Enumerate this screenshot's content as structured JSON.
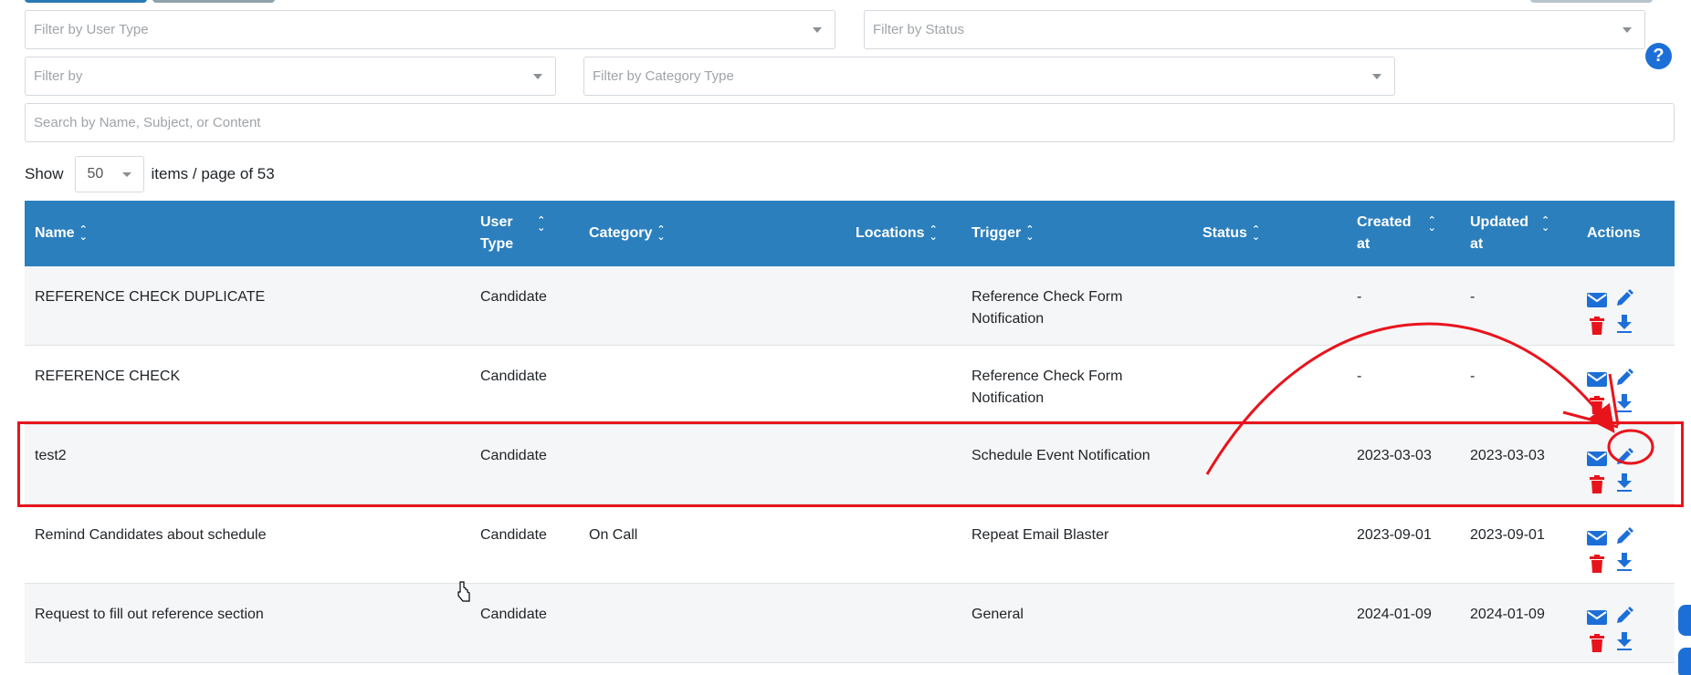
{
  "filters": {
    "user_type_placeholder": "Filter by User Type",
    "status_placeholder": "Filter by Status",
    "filter_by_placeholder": "Filter by",
    "category_type_placeholder": "Filter by Category Type",
    "search_placeholder": "Search by Name, Subject, or Content"
  },
  "help_label": "?",
  "pagination": {
    "show_label": "Show",
    "page_size": "50",
    "items_label": "items / page of 53"
  },
  "table": {
    "headers": {
      "name": "Name",
      "user_type_1": "User",
      "user_type_2": "Type",
      "category": "Category",
      "locations": "Locations",
      "trigger": "Trigger",
      "status": "Status",
      "created_1": "Created",
      "created_2": "at",
      "updated_1": "Updated",
      "updated_2": "at",
      "actions": "Actions"
    },
    "rows": [
      {
        "name": "REFERENCE CHECK DUPLICATE",
        "user_type": "Candidate",
        "category": "",
        "locations": "",
        "trigger_1": "Reference Check Form",
        "trigger_2": "Notification",
        "status": "",
        "created": "-",
        "updated": "-"
      },
      {
        "name": "REFERENCE CHECK",
        "user_type": "Candidate",
        "category": "",
        "locations": "",
        "trigger_1": "Reference Check Form",
        "trigger_2": "Notification",
        "status": "",
        "created": "-",
        "updated": "-"
      },
      {
        "name": "test2",
        "user_type": "Candidate",
        "category": "",
        "locations": "",
        "trigger_1": "Schedule Event Notification",
        "trigger_2": "",
        "status": "",
        "created": "2023-03-03",
        "updated": "2023-03-03"
      },
      {
        "name": "Remind Candidates about schedule",
        "user_type": "Candidate",
        "category": "On Call",
        "locations": "",
        "trigger_1": "Repeat Email Blaster",
        "trigger_2": "",
        "status": "",
        "created": "2023-09-01",
        "updated": "2023-09-01"
      },
      {
        "name": "Request to fill out reference section",
        "user_type": "Candidate",
        "category": "",
        "locations": "",
        "trigger_1": "General",
        "trigger_2": "",
        "status": "",
        "created": "2024-01-09",
        "updated": "2024-01-09"
      }
    ]
  },
  "colors": {
    "header_bg": "#2b7fbd",
    "action_blue": "#1d6fd8",
    "delete_red": "#e8141c",
    "annotation_red": "#e8141c"
  },
  "icons": [
    "chevron-down-icon",
    "sort-icon",
    "mail-icon",
    "edit-icon",
    "trash-icon",
    "download-icon",
    "help-icon",
    "hand-cursor-icon"
  ]
}
